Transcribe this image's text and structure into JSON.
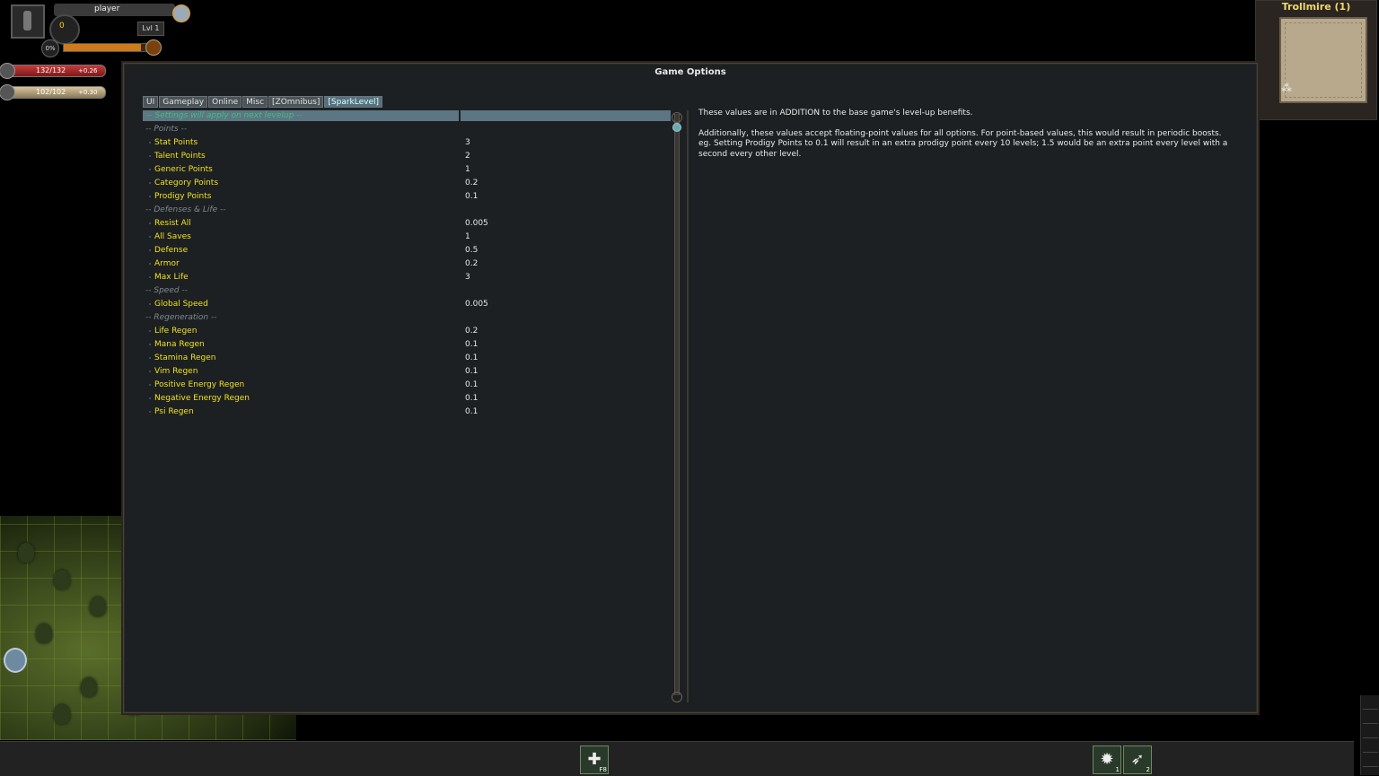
{
  "player": {
    "name": "player",
    "gold": "0",
    "level": "Lvl 1",
    "xp_percent_label": "0%",
    "xp_fraction": 0.0,
    "life": "132/132",
    "life_regen": "+0.26",
    "stamina": "102/102",
    "stamina_regen": "+0.30"
  },
  "minimap": {
    "zone": "Trollmire (1)"
  },
  "dialog": {
    "title": "Game Options",
    "tabs": [
      {
        "label": "UI",
        "active": false
      },
      {
        "label": "Gameplay",
        "active": false
      },
      {
        "label": "Online",
        "active": false
      },
      {
        "label": "Misc",
        "active": false
      },
      {
        "label": "[ZOmnibus]",
        "active": false
      },
      {
        "label": "[SparkLevel]",
        "active": true
      }
    ],
    "header_note": "-- Settings will apply on next levelup --",
    "rows": [
      {
        "type": "section",
        "label": "-- Points --"
      },
      {
        "type": "option",
        "label": "Stat Points",
        "value": "3"
      },
      {
        "type": "option",
        "label": "Talent Points",
        "value": "2"
      },
      {
        "type": "option",
        "label": "Generic Points",
        "value": "1"
      },
      {
        "type": "option",
        "label": "Category Points",
        "value": "0.2"
      },
      {
        "type": "option",
        "label": "Prodigy Points",
        "value": "0.1"
      },
      {
        "type": "section",
        "label": "-- Defenses & Life --"
      },
      {
        "type": "option",
        "label": "Resist All",
        "value": "0.005"
      },
      {
        "type": "option",
        "label": "All Saves",
        "value": "1"
      },
      {
        "type": "option",
        "label": "Defense",
        "value": "0.5"
      },
      {
        "type": "option",
        "label": "Armor",
        "value": "0.2"
      },
      {
        "type": "option",
        "label": "Max Life",
        "value": "3"
      },
      {
        "type": "section",
        "label": "-- Speed --"
      },
      {
        "type": "option",
        "label": "Global Speed",
        "value": "0.005"
      },
      {
        "type": "section",
        "label": "-- Regeneration --"
      },
      {
        "type": "option",
        "label": "Life Regen",
        "value": "0.2"
      },
      {
        "type": "option",
        "label": "Mana Regen",
        "value": "0.1"
      },
      {
        "type": "option",
        "label": "Stamina Regen",
        "value": "0.1"
      },
      {
        "type": "option",
        "label": "Vim Regen",
        "value": "0.1"
      },
      {
        "type": "option",
        "label": "Positive Energy Regen",
        "value": "0.1"
      },
      {
        "type": "option",
        "label": "Negative Energy Regen",
        "value": "0.1"
      },
      {
        "type": "option",
        "label": "Psi Regen",
        "value": "0.1"
      }
    ],
    "description": {
      "p1": "These values are in ADDITION to the base game's level-up benefits.",
      "p2": "Additionally, these values accept floating-point values for all options. For point-based values, this would result in periodic boosts.",
      "p3": "eg. Setting Prodigy Points to 0.1 will result in an extra prodigy point every 10 levels; 1.5 would be an extra point every level with a second every other level."
    }
  },
  "hotbar": {
    "slot1": {
      "icon": "heal-cross-icon",
      "key": "F8"
    },
    "slot2": {
      "icon": "sun-burst-icon",
      "key": "1"
    },
    "slot3": {
      "icon": "wing-icon",
      "key": "2"
    }
  }
}
